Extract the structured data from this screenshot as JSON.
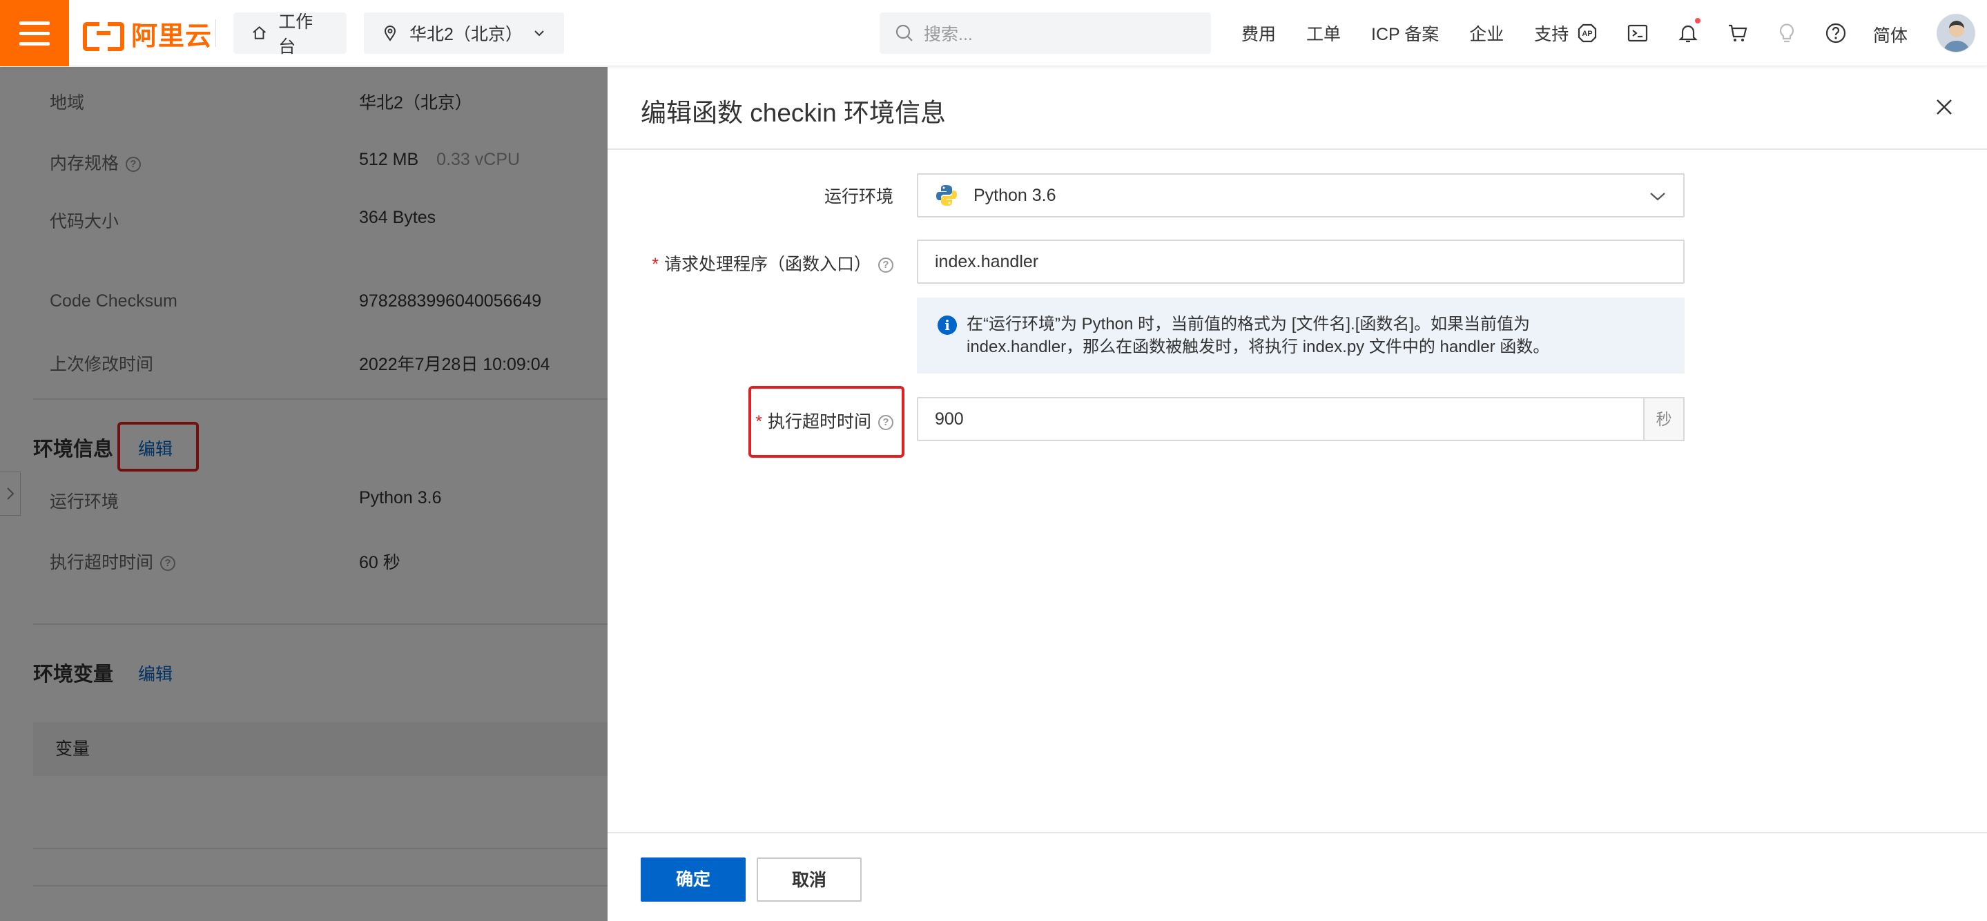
{
  "topbar": {
    "logo_text": "阿里云",
    "workbench_label": "工作台",
    "region_label": "华北2（北京）",
    "search_placeholder": "搜索...",
    "nav_links": [
      "费用",
      "工单",
      "ICP 备案",
      "企业",
      "支持"
    ],
    "lang_label": "简体",
    "brand_color": "#ff6a00"
  },
  "bg_page": {
    "rows": [
      {
        "label": "地域",
        "value": "华北2（北京）",
        "extra": ""
      },
      {
        "label": "内存规格",
        "value": "512 MB",
        "extra": "0.33 vCPU"
      },
      {
        "label": "代码大小",
        "value": "364 Bytes",
        "extra": ""
      },
      {
        "label": "Code Checksum",
        "value": "9782883996040056649",
        "extra": ""
      },
      {
        "label": "上次修改时间",
        "value": "2022年7月28日 10:09:04",
        "extra": ""
      }
    ],
    "env_section": {
      "title": "环境信息",
      "edit_label": "编辑",
      "rows": [
        {
          "label": "运行环境",
          "value": "Python 3.6"
        },
        {
          "label": "执行超时时间",
          "value": "60 秒"
        }
      ]
    },
    "var_section": {
      "title": "环境变量",
      "edit_label": "编辑",
      "table_header": "变量"
    }
  },
  "drawer": {
    "title": "编辑函数 checkin 环境信息",
    "runtime": {
      "label": "运行环境",
      "value": "Python 3.6"
    },
    "handler": {
      "label": "请求处理程序（函数入口）",
      "value": "index.handler",
      "required": true
    },
    "notice": {
      "line1": "在“运行环境”为 Python 时，当前值的格式为 [文件名].[函数名]。如果当前值为",
      "line2": "index.handler，那么在函数被触发时，将执行 index.py 文件中的 handler 函数。"
    },
    "timeout": {
      "label": "执行超时时间",
      "value": "900",
      "unit": "秒",
      "required": true
    },
    "confirm_label": "确定",
    "cancel_label": "取消",
    "primary_color": "#0064c8"
  }
}
